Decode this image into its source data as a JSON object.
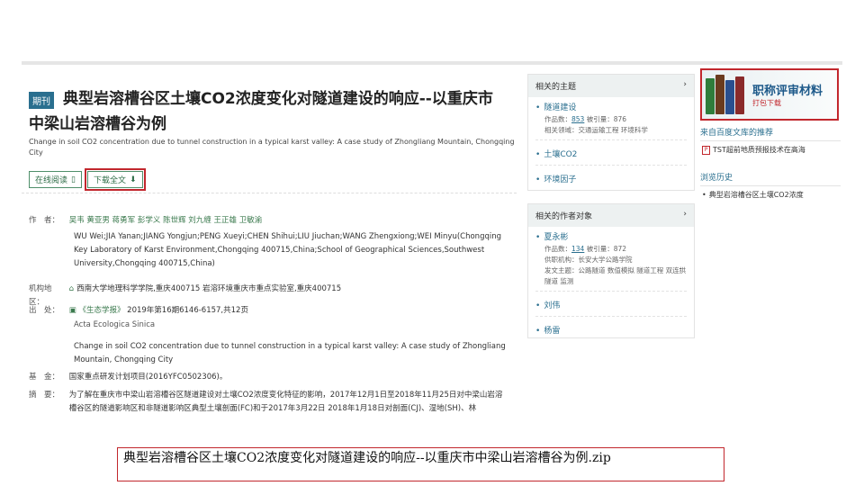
{
  "article": {
    "badge": "期刊",
    "title": "典型岩溶槽谷区土壤CO2浓度变化对隧道建设的响应--以重庆市中梁山岩溶槽谷为例",
    "en_title": "Change in soil CO2 concentration due to tunnel construction in a typical karst valley: A case study of Zhongliang Mountain, Chongqing City",
    "buttons": {
      "read_online": "在线阅读",
      "download": "下载全文"
    },
    "authors_label": "作　者：",
    "authors": [
      "吴韦",
      "黄亚男",
      "蒋勇军",
      "彭学义",
      "陈世辉",
      "刘九缠",
      "王正雄",
      "卫敏渝"
    ],
    "authors_en": "WU Wei;JIA Yanan;JIANG Yongjun;PENG Xueyi;CHEN Shihui;LIU Jiuchan;WANG Zhengxiong;WEI Minyu(Chongqing Key Laboratory of Karst Environment,Chongqing 400715,China;School of Geographical Sciences,Southwest University,Chongqing 400715,China)",
    "inst_label": "机构地区：",
    "institutions": [
      "西南大学地理科学学院,重庆400715",
      "岩溶环境重庆市重点实验室,重庆400715"
    ],
    "source_label": "出　处：",
    "journal": "《生态学报》",
    "issue": "2019年第16期6146-6157,共12页",
    "journal_en": "Acta Ecologica Sinica",
    "source_en": "Change in soil CO2 concentration due to tunnel construction in a typical karst valley: A case study of Zhongliang Mountain, Chongqing City",
    "fund_label": "基　金：",
    "fund": "国家重点研发计划项目(2016YFC0502306)。",
    "abstract_label": "摘　要：",
    "abstract": "为了解在重庆市中梁山岩溶槽谷区隧道建设对土壤CO2浓度变化特征的影响，2017年12月1日至2018年11月25日对中梁山岩溶槽谷区的隧道影响区和非隧道影响区典型土壤剖面(FC)和于2017年3月22日 2018年1月18日对剖面(CJ)、湿地(SH)、林"
  },
  "sidebar": {
    "related_topics": {
      "title": "相关的主题",
      "items": [
        {
          "name": "隧道建设",
          "stats_prefix": "作品数：",
          "works": "853",
          "stats_mid": "  被引量：",
          "cites": "876",
          "related": "相关领域：交通运输工程 环境科学"
        },
        {
          "name": "土壤CO2"
        },
        {
          "name": "环境因子"
        }
      ]
    },
    "related_authors": {
      "title": "相关的作者对象",
      "items": [
        {
          "name": "夏永彬",
          "stats_prefix": "作品数：",
          "works": "134",
          "stats_mid": "  被引量：",
          "cites": "872",
          "org": "供职机构：长安大学公路学院",
          "topics": "发文主题：公路隧道 数值模拟 隧道工程 双连拱隧道 监测"
        },
        {
          "name": "刘伟"
        },
        {
          "name": "杨雷"
        }
      ]
    }
  },
  "right": {
    "ad_title": "职称评审材料",
    "ad_sub": "打包下载",
    "library_title": "来自百度文库的推荐",
    "library_item": "TST超前地质预报技术在高海",
    "history_title": "浏览历史",
    "history_item": "典型岩溶槽谷区土壤CO2浓度"
  },
  "caption": "典型岩溶槽谷区土壤CO2浓度变化对隧道建设的响应--以重庆市中梁山岩溶槽谷为例.zip",
  "colors": {
    "accent": "#2a6f8f",
    "highlight": "#c2272d",
    "green": "#3b7a4e"
  }
}
